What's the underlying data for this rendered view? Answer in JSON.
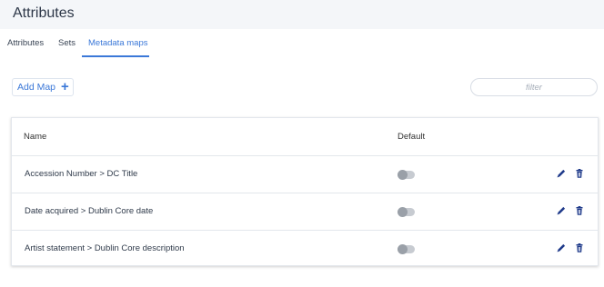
{
  "header": {
    "title": "Attributes"
  },
  "tabs": [
    {
      "label": "Attributes",
      "active": false
    },
    {
      "label": "Sets",
      "active": false
    },
    {
      "label": "Metadata maps",
      "active": true
    }
  ],
  "toolbar": {
    "add_label": "Add Map",
    "add_icon": "+",
    "filter_placeholder": "filter"
  },
  "table": {
    "columns": [
      "Name",
      "Default"
    ],
    "rows": [
      {
        "name": "Accession Number > DC Title",
        "default": false
      },
      {
        "name": "Date acquired > Dublin Core date",
        "default": false
      },
      {
        "name": "Artist statement > Dublin Core description",
        "default": false
      }
    ]
  },
  "colors": {
    "accent": "#3b78d8",
    "icon": "#1f3a8a",
    "header_bg": "#f4f6f9"
  },
  "icons": {
    "edit": "pencil-icon",
    "delete": "trash-icon"
  }
}
